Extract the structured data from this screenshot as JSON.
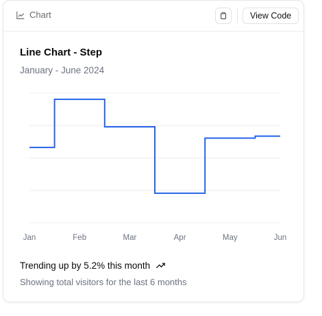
{
  "header": {
    "tag_label": "Chart",
    "tag_icon": "line-chart-icon",
    "copy_icon": "clipboard-icon",
    "view_code_label": "View Code"
  },
  "card": {
    "title": "Line Chart - Step",
    "subtitle": "January - June 2024",
    "trend_text": "Trending up by 5.2% this month",
    "trend_icon": "trending-up-icon",
    "footer_text": "Showing total visitors for the last 6 months"
  },
  "chart_data": {
    "type": "line",
    "interpolation": "step",
    "categories": [
      "Jan",
      "Feb",
      "Mar",
      "Apr",
      "May",
      "Jun"
    ],
    "values": [
      186,
      305,
      237,
      73,
      209,
      214
    ],
    "ylim": [
      0,
      320
    ],
    "grid": true,
    "color": "#2563eb"
  }
}
